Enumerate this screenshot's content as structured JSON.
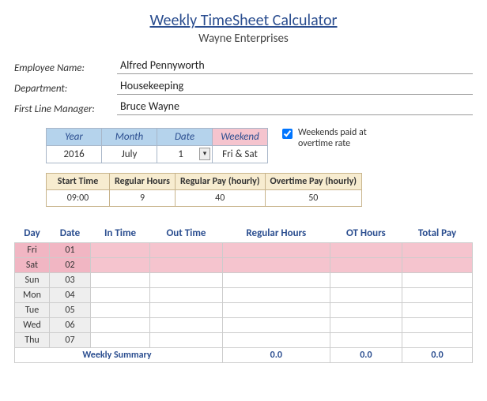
{
  "title": "Weekly TimeSheet Calculator",
  "company": "Wayne Enterprises",
  "info": {
    "employee_label": "Employee Name:",
    "employee_value": "Alfred Pennyworth",
    "dept_label": "Department:",
    "dept_value": "Housekeeping",
    "manager_label": "First Line Manager:",
    "manager_value": "Bruce Wayne"
  },
  "params": {
    "year_h": "Year",
    "year_v": "2016",
    "month_h": "Month",
    "month_v": "July",
    "date_h": "Date",
    "date_v": "1",
    "weekend_h": "Weekend",
    "weekend_v": "Fri & Sat"
  },
  "checkbox_label": "Weekends paid at overtime rate",
  "rates": {
    "start_h": "Start Time",
    "start_v": "09:00",
    "reghrs_h": "Regular Hours",
    "reghrs_v": "9",
    "regpay_h": "Regular Pay (hourly)",
    "regpay_v": "40",
    "otpay_h": "Overtime Pay (hourly)",
    "otpay_v": "50"
  },
  "sheet_headers": {
    "day": "Day",
    "date": "Date",
    "in": "In Time",
    "out": "Out Time",
    "reg": "Regular Hours",
    "ot": "OT Hours",
    "total": "Total Pay"
  },
  "rows": [
    {
      "day": "Fri",
      "date": "01",
      "weekend": true
    },
    {
      "day": "Sat",
      "date": "02",
      "weekend": true
    },
    {
      "day": "Sun",
      "date": "03",
      "weekend": false
    },
    {
      "day": "Mon",
      "date": "04",
      "weekend": false
    },
    {
      "day": "Tue",
      "date": "05",
      "weekend": false
    },
    {
      "day": "Wed",
      "date": "06",
      "weekend": false
    },
    {
      "day": "Thu",
      "date": "07",
      "weekend": false
    }
  ],
  "summary": {
    "label": "Weekly Summary",
    "reg": "0.0",
    "ot": "0.0",
    "total": "0.0"
  }
}
